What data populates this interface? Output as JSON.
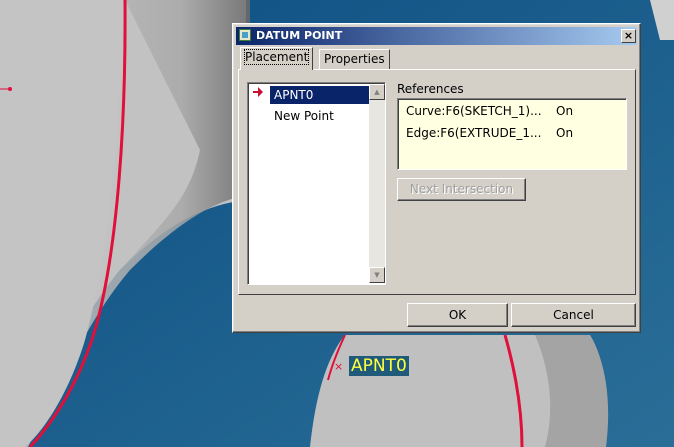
{
  "dialog": {
    "title": "DATUM POINT",
    "close_glyph": "×"
  },
  "tabs": [
    {
      "label": "Placement",
      "active": true
    },
    {
      "label": "Properties",
      "active": false
    }
  ],
  "point_list": {
    "items": [
      {
        "label": "APNT0",
        "selected": true
      },
      {
        "label": "New Point",
        "selected": false
      }
    ],
    "current_marker_icon": "right-arrow-icon"
  },
  "references": {
    "label": "References",
    "rows": [
      {
        "name": "Curve:F6(SKETCH_1)...",
        "status": "On"
      },
      {
        "name": "Edge:F6(EXTRUDE_1...",
        "status": "On"
      }
    ]
  },
  "buttons": {
    "next_intersection": "Next Intersection",
    "ok": "OK",
    "cancel": "Cancel"
  },
  "viewport": {
    "point_label": "APNT0",
    "point_marker_glyph": "×"
  },
  "colors": {
    "background": "#1b5f8e",
    "model_surface": "#c0c0c0",
    "curve_highlight": "#e0103a",
    "label_text": "#ffff40",
    "title_gradient_start": "#0a246a",
    "title_gradient_end": "#a6caf0"
  }
}
